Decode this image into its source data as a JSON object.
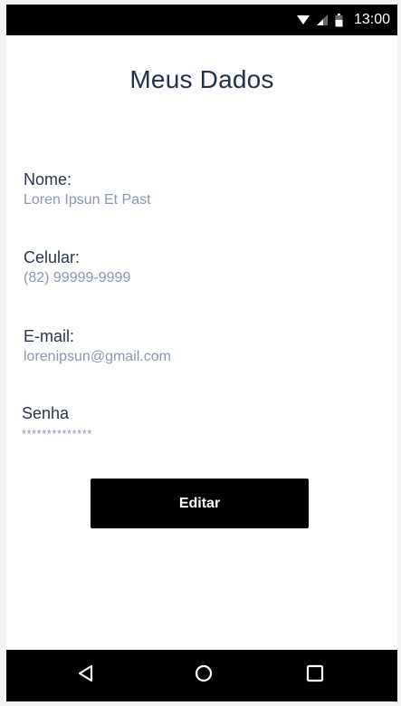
{
  "status_bar": {
    "time": "13:00",
    "icons": [
      "wifi-icon",
      "signal-icon",
      "battery-icon"
    ]
  },
  "header": {
    "title": "Meus Dados"
  },
  "profile": {
    "name": {
      "label": "Nome:",
      "value": "Loren Ipsun Et Past"
    },
    "phone": {
      "label": "Celular:",
      "value": "(82) 99999-9999"
    },
    "email": {
      "label": "E-mail:",
      "value": "lorenipsun@gmail.com"
    },
    "password": {
      "label": "Senha",
      "value": "**************"
    }
  },
  "actions": {
    "edit_label": "Editar"
  },
  "nav_bar": {
    "icons": [
      "back-icon",
      "home-icon",
      "recent-apps-icon"
    ]
  },
  "colors": {
    "title": "#22314a",
    "label": "#2a3547",
    "value": "#8a97ad",
    "button": "#000000",
    "system_bars": "#000000"
  }
}
